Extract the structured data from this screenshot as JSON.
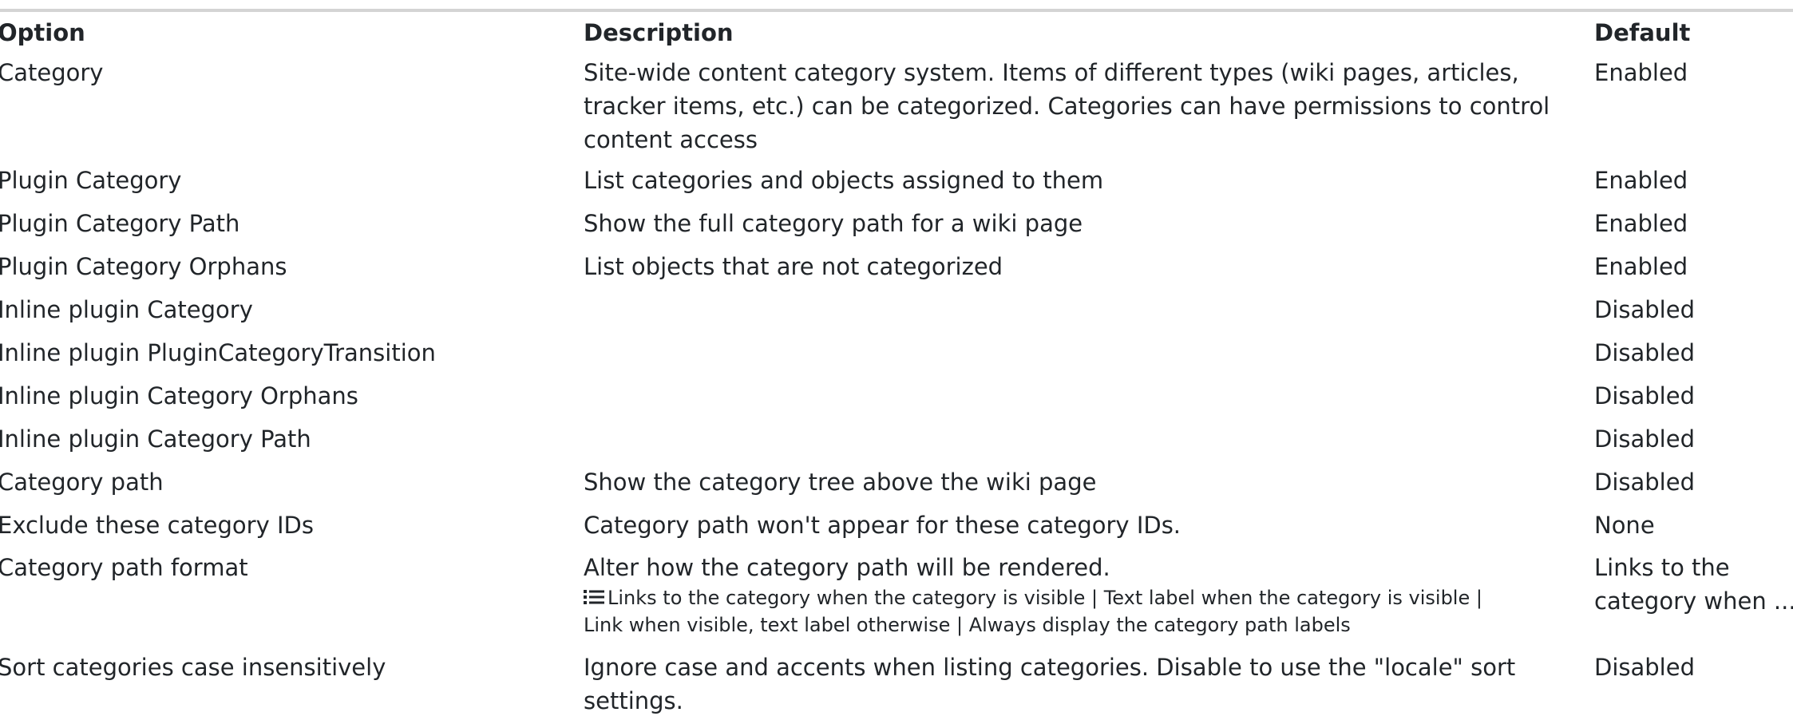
{
  "table": {
    "headers": {
      "option": "Option",
      "description": "Description",
      "default": "Default"
    },
    "rows": [
      {
        "option": "Category",
        "description_lines": [
          "Site-wide content category system. Items of different types (wiki pages, articles,",
          "tracker items, etc.) can be categorized. Categories can have permissions to control",
          "content access"
        ],
        "default_lines": [
          "Enabled"
        ]
      },
      {
        "option": "Plugin Category",
        "description_lines": [
          "List categories and objects assigned to them"
        ],
        "default_lines": [
          "Enabled"
        ]
      },
      {
        "option": "Plugin Category Path",
        "description_lines": [
          "Show the full category path for a wiki page"
        ],
        "default_lines": [
          "Enabled"
        ]
      },
      {
        "option": "Plugin Category Orphans",
        "description_lines": [
          "List objects that are not categorized"
        ],
        "default_lines": [
          "Enabled"
        ]
      },
      {
        "option": "Inline plugin Category",
        "description_lines": [],
        "default_lines": [
          "Disabled"
        ]
      },
      {
        "option": "Inline plugin PluginCategoryTransition",
        "description_lines": [],
        "default_lines": [
          "Disabled"
        ]
      },
      {
        "option": "Inline plugin Category Orphans",
        "description_lines": [],
        "default_lines": [
          "Disabled"
        ]
      },
      {
        "option": "Inline plugin Category Path",
        "description_lines": [],
        "default_lines": [
          "Disabled"
        ]
      },
      {
        "option": "Category path",
        "description_lines": [
          "Show the category tree above the wiki page"
        ],
        "default_lines": [
          "Disabled"
        ]
      },
      {
        "option": "Exclude these category IDs",
        "description_lines": [
          "Category path won't appear for these category IDs."
        ],
        "default_lines": [
          "None"
        ]
      },
      {
        "option": "Category path format",
        "description_lines": [
          "Alter how the category path will be rendered."
        ],
        "options_icon": "list-icon",
        "options_lines": [
          "Links to the category when the category is visible | Text label when the category is visible |",
          "Link when visible, text label otherwise | Always display the category path labels"
        ],
        "default_lines": [
          "Links to the",
          "category when ..."
        ]
      },
      {
        "option": "Sort categories case insensitively",
        "description_lines": [
          "Ignore case and accents when listing categories. Disable to use the \"locale\" sort",
          "settings."
        ],
        "default_lines": [
          "Disabled"
        ]
      }
    ]
  }
}
